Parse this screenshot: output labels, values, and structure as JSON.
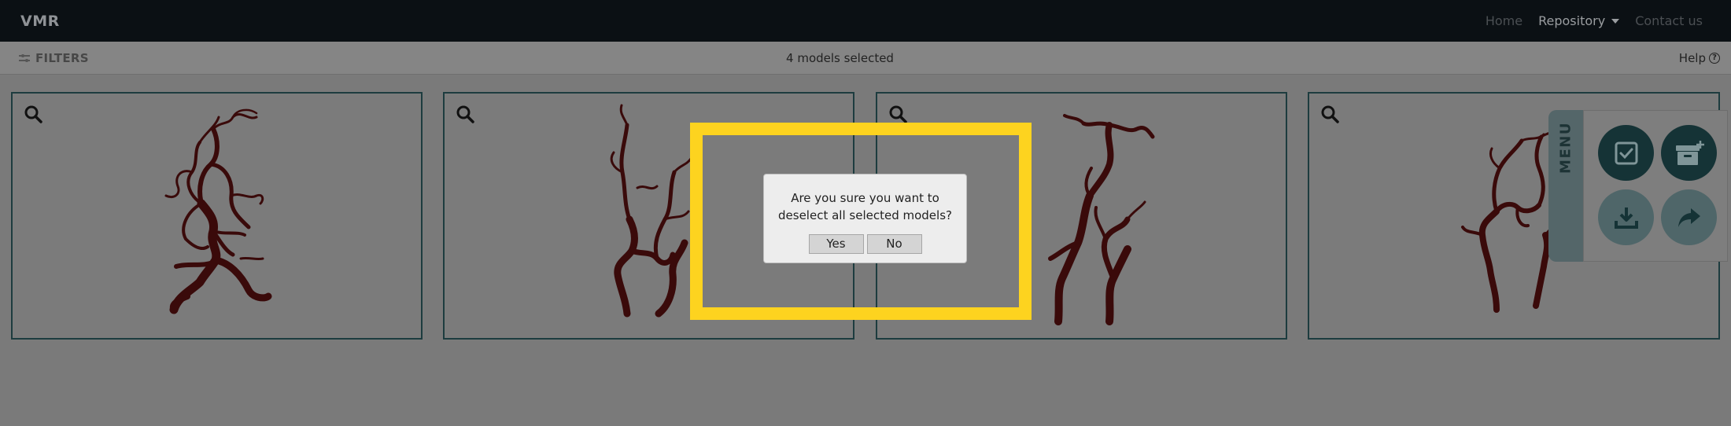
{
  "navbar": {
    "brand": "VMR",
    "links": [
      "Home",
      "Repository",
      "Contact us"
    ]
  },
  "filterbar": {
    "filters_label": "FILTERS",
    "selected_text": "4 models selected",
    "help_label": "Help"
  },
  "cards": [
    {
      "zoom_icon": "search-icon"
    },
    {
      "zoom_icon": "search-icon"
    },
    {
      "zoom_icon": "search-icon"
    },
    {
      "zoom_icon": "search-icon"
    }
  ],
  "dialog": {
    "message_line1": "Are you sure you want to",
    "message_line2": "deselect all selected models?",
    "yes_label": "Yes",
    "no_label": "No"
  },
  "side_menu": {
    "tab_label": "MENU",
    "buttons": [
      "checkbox-icon",
      "archive-add-icon",
      "download-icon",
      "share-icon"
    ]
  },
  "colors": {
    "highlight": "#fdd31f",
    "vessel": "#3a0a0a",
    "menu_dark": "#153336",
    "menu_light": "#4f6669"
  }
}
